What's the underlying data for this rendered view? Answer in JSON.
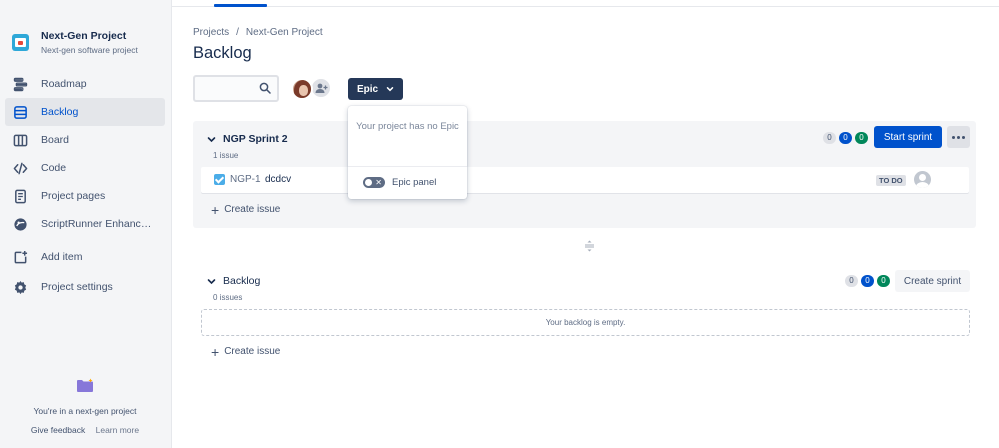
{
  "project": {
    "name": "Next-Gen Project",
    "type": "Next-gen software project"
  },
  "sidebar": {
    "items": [
      {
        "label": "Roadmap",
        "icon": "roadmap-icon"
      },
      {
        "label": "Backlog",
        "icon": "backlog-icon",
        "active": true
      },
      {
        "label": "Board",
        "icon": "board-icon"
      },
      {
        "label": "Code",
        "icon": "code-icon"
      },
      {
        "label": "Project pages",
        "icon": "pages-icon"
      },
      {
        "label": "ScriptRunner Enhanced ...",
        "icon": "scriptrunner-icon"
      },
      {
        "label": "Add item",
        "icon": "add-item-icon"
      },
      {
        "label": "Project settings",
        "icon": "gear-icon"
      }
    ],
    "footer": {
      "message": "You're in a next-gen project",
      "feedback": "Give feedback",
      "learn_more": "Learn more"
    }
  },
  "breadcrumb": {
    "items": [
      "Projects",
      "Next-Gen Project"
    ],
    "separator": "/"
  },
  "page_title": "Backlog",
  "search": {
    "placeholder": "",
    "value": ""
  },
  "epic_button": {
    "label": "Epic"
  },
  "epic_popup": {
    "message": "Your project has no Epic",
    "toggle_label": "Epic panel",
    "toggle_on": false
  },
  "sprint": {
    "name": "NGP Sprint 2",
    "issue_count": "1 issue",
    "counts": {
      "todo": "0",
      "in_progress": "0",
      "done": "0"
    },
    "start_label": "Start sprint",
    "issues": [
      {
        "key": "NGP-1",
        "summary": "dcdcv",
        "status": "TO DO"
      }
    ],
    "create_issue": "Create issue"
  },
  "backlog": {
    "name": "Backlog",
    "issue_count": "0 issues",
    "counts": {
      "todo": "0",
      "in_progress": "0",
      "done": "0"
    },
    "create_sprint": "Create sprint",
    "empty_message": "Your backlog is empty.",
    "create_issue": "Create issue"
  },
  "colors": {
    "primary": "#0052cc",
    "epic_button": "#253858",
    "done_green": "#00875a",
    "story_check": "#4bade8"
  }
}
